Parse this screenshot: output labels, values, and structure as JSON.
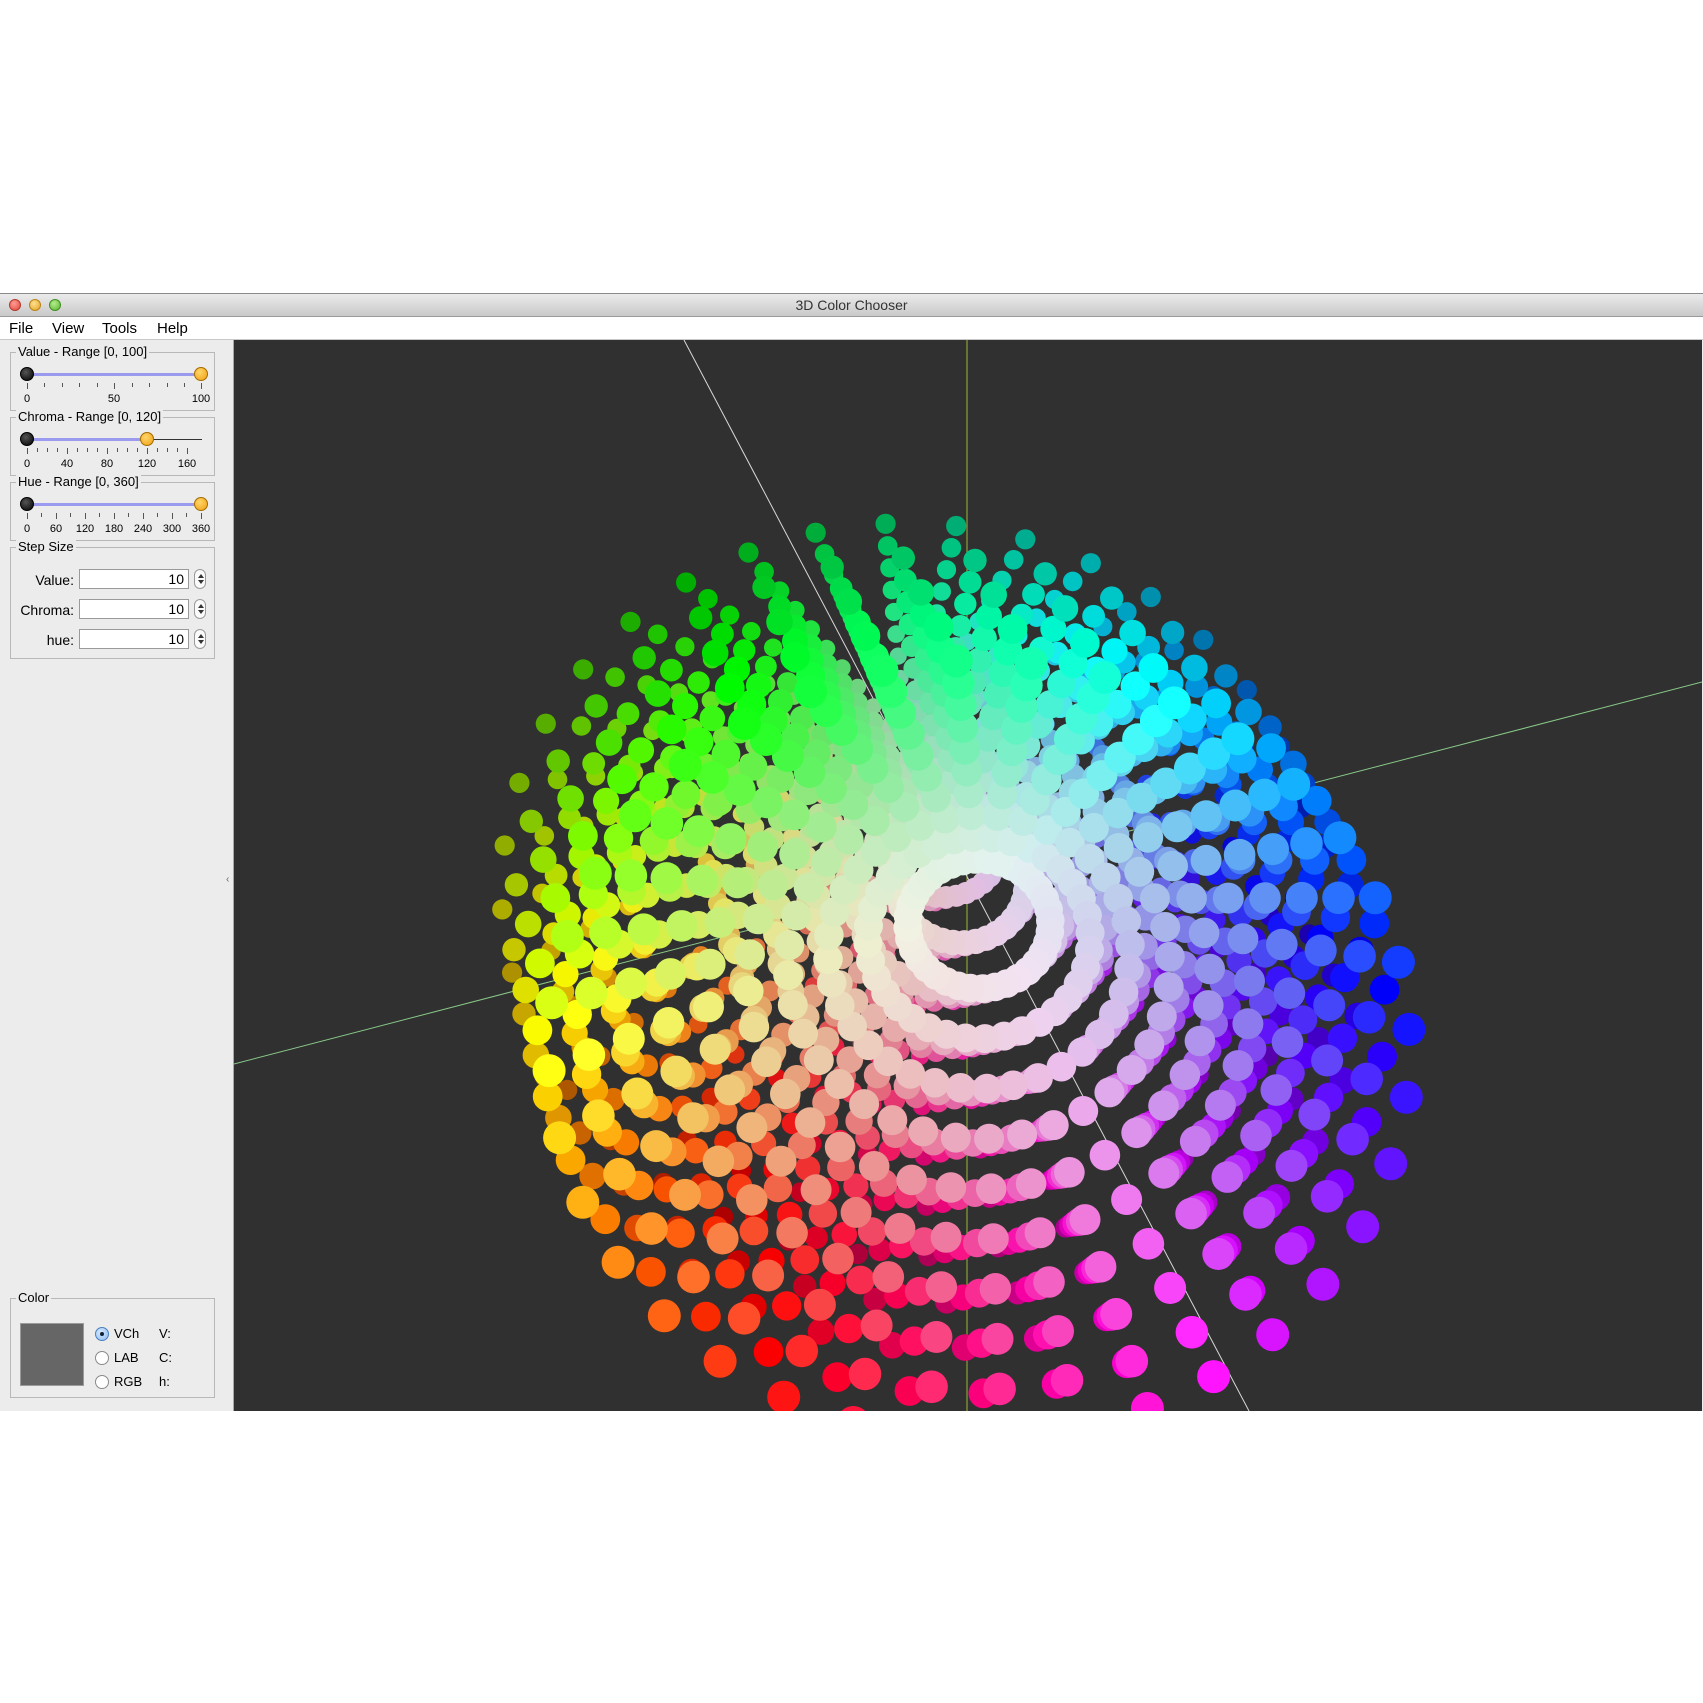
{
  "window": {
    "title": "3D Color Chooser"
  },
  "menu": [
    "File",
    "View",
    "Tools",
    "Help"
  ],
  "value_range": {
    "title": "Value - Range [0, 100]",
    "scale_labels": [
      "0",
      "50",
      "100"
    ],
    "low": 0,
    "high": 100
  },
  "chroma_range": {
    "title": "Chroma - Range [0, 120]",
    "scale_labels": [
      "0",
      "40",
      "80",
      "120",
      "160"
    ],
    "low": 0,
    "high": 120,
    "max": 160
  },
  "hue_range": {
    "title": "Hue - Range [0, 360]",
    "scale_labels": [
      "0",
      "60",
      "120",
      "180",
      "240",
      "300",
      "360"
    ],
    "low": 0,
    "high": 360
  },
  "step_size": {
    "title": "Step Size",
    "value": {
      "label": "Value:",
      "input": "10"
    },
    "chroma": {
      "label": "Chroma:",
      "input": "10"
    },
    "hue": {
      "label": "hue:",
      "input": "10"
    }
  },
  "color_panel": {
    "title": "Color",
    "swatch_color": "#666666",
    "modes": [
      "VCh",
      "LAB",
      "RGB"
    ],
    "selected_mode": "VCh",
    "fields": [
      "V:",
      "C:",
      "h:"
    ]
  },
  "viewport": {
    "background": "#303030",
    "axis_colors": {
      "x": "#c87a7a",
      "y": "#9ab83a",
      "z": "#7a7ad8",
      "w": "#d8d8d8",
      "g": "#88c888"
    }
  }
}
